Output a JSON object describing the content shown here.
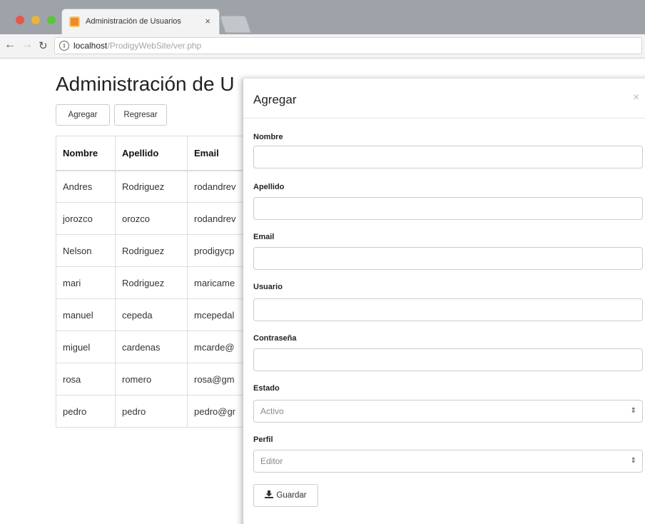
{
  "browser": {
    "tab_title": "Administración de Usuarios",
    "tab_close": "×",
    "url_host": "localhost",
    "url_path": "/ProdigyWebSite/ver.php"
  },
  "page": {
    "title": "Administración de U",
    "buttons": {
      "agregar": "Agregar",
      "regresar": "Regresar"
    },
    "table": {
      "headers": [
        "Nombre",
        "Apellido",
        "Email"
      ],
      "rows": [
        [
          "Andres",
          "Rodriguez",
          "rodandrev"
        ],
        [
          "jorozco",
          "orozco",
          "rodandrev"
        ],
        [
          "Nelson",
          "Rodriguez",
          "prodigycp"
        ],
        [
          "mari",
          "Rodriguez",
          "maricame"
        ],
        [
          "manuel",
          "cepeda",
          "mcepedal"
        ],
        [
          "miguel",
          "cardenas",
          "mcarde@"
        ],
        [
          "rosa",
          "romero",
          "rosa@gm"
        ],
        [
          "pedro",
          "pedro",
          "pedro@gr"
        ]
      ]
    }
  },
  "modal": {
    "title": "Agregar",
    "close": "×",
    "fields": {
      "nombre": "Nombre",
      "apellido": "Apellido",
      "email": "Email",
      "usuario": "Usuario",
      "contrasena": "Contraseña",
      "estado": "Estado",
      "perfil": "Perfil"
    },
    "estado_value": "Activo",
    "perfil_value": "Editor",
    "save_label": "Guardar"
  },
  "colors": {
    "titlebar": "#9da3a8",
    "close_dot": "#e8554b",
    "minimize_dot": "#e9b43a",
    "zoom_dot": "#5cc33f",
    "favicon": "#f08a24"
  },
  "icons": [
    "info-icon",
    "back-arrow-icon",
    "forward-arrow-icon",
    "reload-icon",
    "close-icon",
    "select-arrow-icon",
    "download-icon"
  ]
}
